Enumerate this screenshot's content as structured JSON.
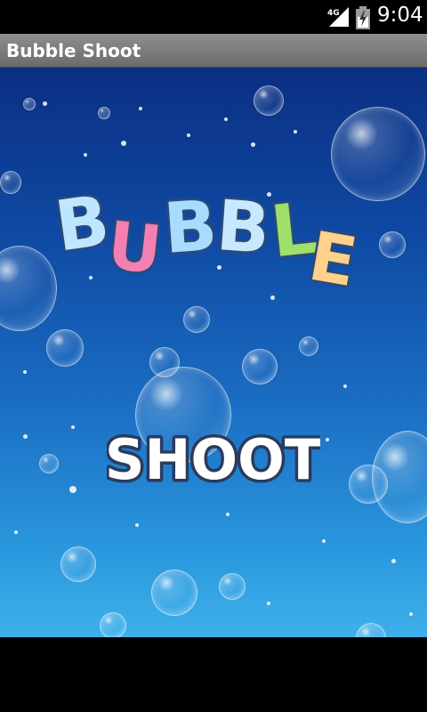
{
  "status_bar": {
    "network": "4G",
    "time": "9:04",
    "icons": [
      "signal-icon",
      "battery-icon"
    ]
  },
  "app": {
    "title": "Bubble Shoot"
  },
  "game": {
    "logo_word_1": "BUBBLE",
    "logo_letters": [
      "B",
      "U",
      "B",
      "B",
      "L",
      "E"
    ],
    "logo_word_2": "SHOOT",
    "colors": {
      "background_top": "#0a2f82",
      "background_bottom": "#3fb0ea",
      "letter_colors": [
        "#bfe6ff",
        "#f47fb3",
        "#a8dcff",
        "#c6e9ff",
        "#9ee06a",
        "#ffd18a"
      ],
      "shoot_fill": "#ffffff",
      "shoot_outline": "#2a3b5c"
    }
  }
}
